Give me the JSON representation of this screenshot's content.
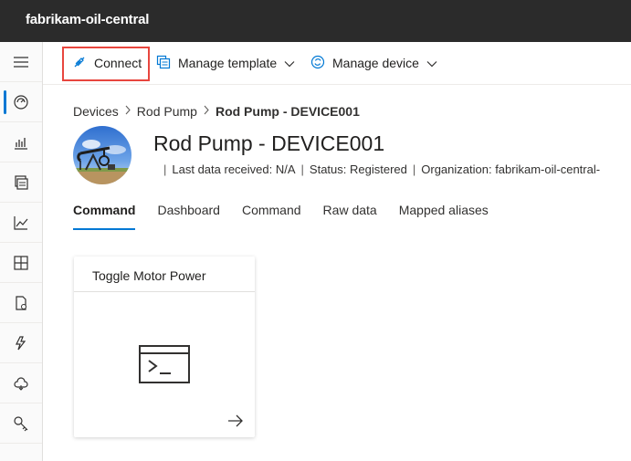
{
  "app": {
    "title": "fabrikam-oil-central"
  },
  "toolbar": {
    "connect_label": "Connect",
    "manage_template_label": "Manage template",
    "manage_device_label": "Manage device"
  },
  "breadcrumb": {
    "items": [
      "Devices",
      "Rod Pump"
    ],
    "current": "Rod Pump - DEVICE001"
  },
  "device": {
    "title": "Rod Pump - DEVICE001",
    "last_data": "Last data received: N/A",
    "status": "Status: Registered",
    "organization": "Organization: fabrikam-oil-central-"
  },
  "tabs": [
    {
      "label": "Command",
      "active": true
    },
    {
      "label": "Dashboard",
      "active": false
    },
    {
      "label": "Command",
      "active": false
    },
    {
      "label": "Raw data",
      "active": false
    },
    {
      "label": "Mapped aliases",
      "active": false
    }
  ],
  "command_tile": {
    "title": "Toggle Motor Power"
  },
  "colors": {
    "accent": "#0078d4",
    "highlight": "#e8463e",
    "topbar": "#2b2b2b"
  },
  "nav_icons": [
    "hamburger-icon",
    "dashboard-icon",
    "analytics-icon",
    "devices-icon",
    "chart-icon",
    "dashboard-grid-icon",
    "file-icon",
    "rules-icon",
    "cloud-icon",
    "key-icon"
  ]
}
